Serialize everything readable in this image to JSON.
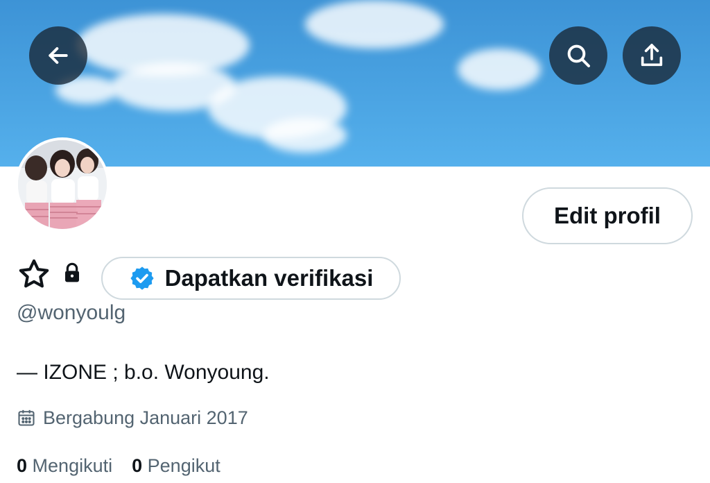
{
  "header": {
    "back_icon": "arrow-left-icon",
    "search_icon": "search-icon",
    "share_icon": "share-upload-icon"
  },
  "profile": {
    "edit_label": "Edit profil",
    "verify_label": "Dapatkan verifikasi",
    "handle": "@wonyoulg",
    "bio": "— IZONE ; b.o. Wonyoung.",
    "joined": "Bergabung Januari 2017",
    "following_count": "0",
    "following_label": "Mengikuti",
    "followers_count": "0",
    "followers_label": "Pengikut"
  },
  "colors": {
    "verified_blue": "#1d9bf0",
    "text_primary": "#0f1419",
    "text_secondary": "#536471",
    "border": "#cfd9de"
  }
}
